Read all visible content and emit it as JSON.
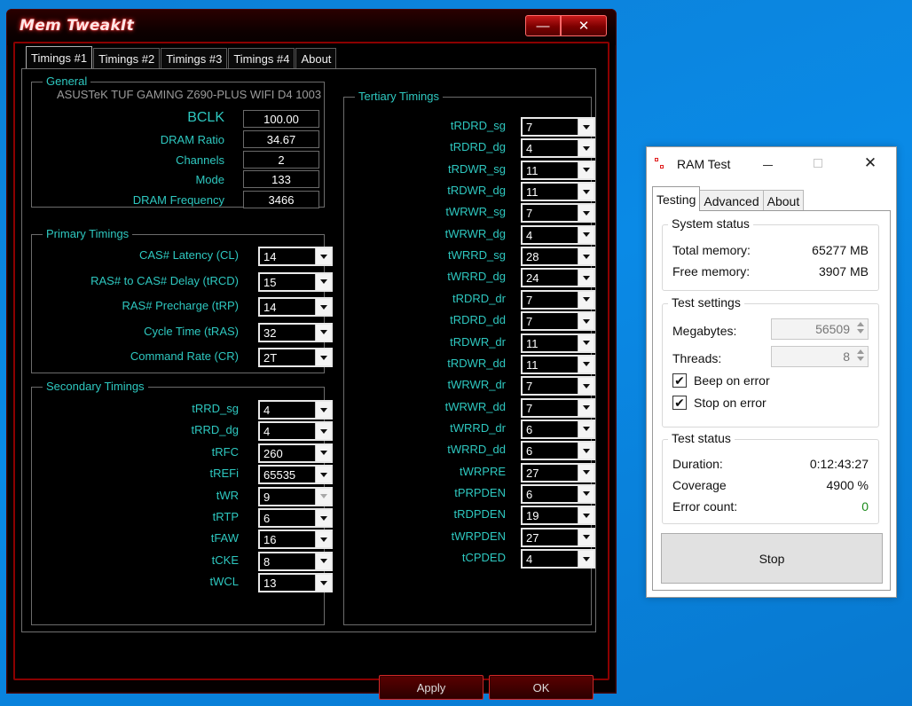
{
  "memtweakit": {
    "title": "Mem TweakIt",
    "window_buttons": {
      "minimize": "—",
      "close": "✕"
    },
    "tabs": [
      "Timings #1",
      "Timings #2",
      "Timings #3",
      "Timings #4",
      "About"
    ],
    "active_tab": "Timings #1",
    "general": {
      "title": "General",
      "motherboard": "ASUSTeK TUF GAMING Z690-PLUS WIFI D4 1003",
      "fields": [
        {
          "label": "BCLK",
          "value": "100.00"
        },
        {
          "label": "DRAM Ratio",
          "value": "34.67"
        },
        {
          "label": "Channels",
          "value": "2"
        },
        {
          "label": "Mode",
          "value": "133"
        },
        {
          "label": "DRAM Frequency",
          "value": "3466"
        }
      ]
    },
    "primary": {
      "title": "Primary Timings",
      "fields": [
        {
          "label": "CAS# Latency (CL)",
          "value": "14"
        },
        {
          "label": "RAS# to CAS# Delay (tRCD)",
          "value": "15"
        },
        {
          "label": "RAS# Precharge (tRP)",
          "value": "14"
        },
        {
          "label": "Cycle Time (tRAS)",
          "value": "32"
        },
        {
          "label": "Command Rate (CR)",
          "value": "2T"
        }
      ]
    },
    "secondary": {
      "title": "Secondary Timings",
      "fields": [
        {
          "label": "tRRD_sg",
          "value": "4"
        },
        {
          "label": "tRRD_dg",
          "value": "4"
        },
        {
          "label": "tRFC",
          "value": "260"
        },
        {
          "label": "tREFi",
          "value": "65535"
        },
        {
          "label": "tWR",
          "value": "9"
        },
        {
          "label": "tRTP",
          "value": "6"
        },
        {
          "label": "tFAW",
          "value": "16"
        },
        {
          "label": "tCKE",
          "value": "8"
        },
        {
          "label": "tWCL",
          "value": "13"
        }
      ]
    },
    "tertiary": {
      "title": "Tertiary Timings",
      "fields": [
        {
          "label": "tRDRD_sg",
          "value": "7"
        },
        {
          "label": "tRDRD_dg",
          "value": "4"
        },
        {
          "label": "tRDWR_sg",
          "value": "11"
        },
        {
          "label": "tRDWR_dg",
          "value": "11"
        },
        {
          "label": "tWRWR_sg",
          "value": "7"
        },
        {
          "label": "tWRWR_dg",
          "value": "4"
        },
        {
          "label": "tWRRD_sg",
          "value": "28"
        },
        {
          "label": "tWRRD_dg",
          "value": "24"
        },
        {
          "label": "tRDRD_dr",
          "value": "7"
        },
        {
          "label": "tRDRD_dd",
          "value": "7"
        },
        {
          "label": "tRDWR_dr",
          "value": "11"
        },
        {
          "label": "tRDWR_dd",
          "value": "11"
        },
        {
          "label": "tWRWR_dr",
          "value": "7"
        },
        {
          "label": "tWRWR_dd",
          "value": "7"
        },
        {
          "label": "tWRRD_dr",
          "value": "6"
        },
        {
          "label": "tWRRD_dd",
          "value": "6"
        },
        {
          "label": "tWRPRE",
          "value": "27"
        },
        {
          "label": "tPRPDEN",
          "value": "6"
        },
        {
          "label": "tRDPDEN",
          "value": "19"
        },
        {
          "label": "tWRPDEN",
          "value": "27"
        },
        {
          "label": "tCPDED",
          "value": "4"
        }
      ]
    },
    "buttons": {
      "apply": "Apply",
      "ok": "OK"
    }
  },
  "ramtest": {
    "title": "RAM Test",
    "window_buttons": {
      "close": "✕"
    },
    "tabs": [
      "Testing",
      "Advanced",
      "About"
    ],
    "active_tab": "Testing",
    "system_status": {
      "title": "System status",
      "total_memory_label": "Total memory:",
      "total_memory_value": "65277 MB",
      "free_memory_label": "Free memory:",
      "free_memory_value": "3907 MB"
    },
    "test_settings": {
      "title": "Test settings",
      "megabytes_label": "Megabytes:",
      "megabytes_value": "56509",
      "threads_label": "Threads:",
      "threads_value": "8",
      "beep_label": "Beep on error",
      "beep_checked": true,
      "stop_label": "Stop on error",
      "stop_checked": true,
      "check_mark": "✔"
    },
    "test_status": {
      "title": "Test status",
      "duration_label": "Duration:",
      "duration_value": "0:12:43:27",
      "coverage_label": "Coverage",
      "coverage_value": "4900 %",
      "error_label": "Error count:",
      "error_value": "0"
    },
    "stop_button": "Stop",
    "colors": {
      "error_count": "#1a8a1a",
      "accent_red": "#8b0000",
      "label_cyan": "#2ec8c0"
    }
  }
}
